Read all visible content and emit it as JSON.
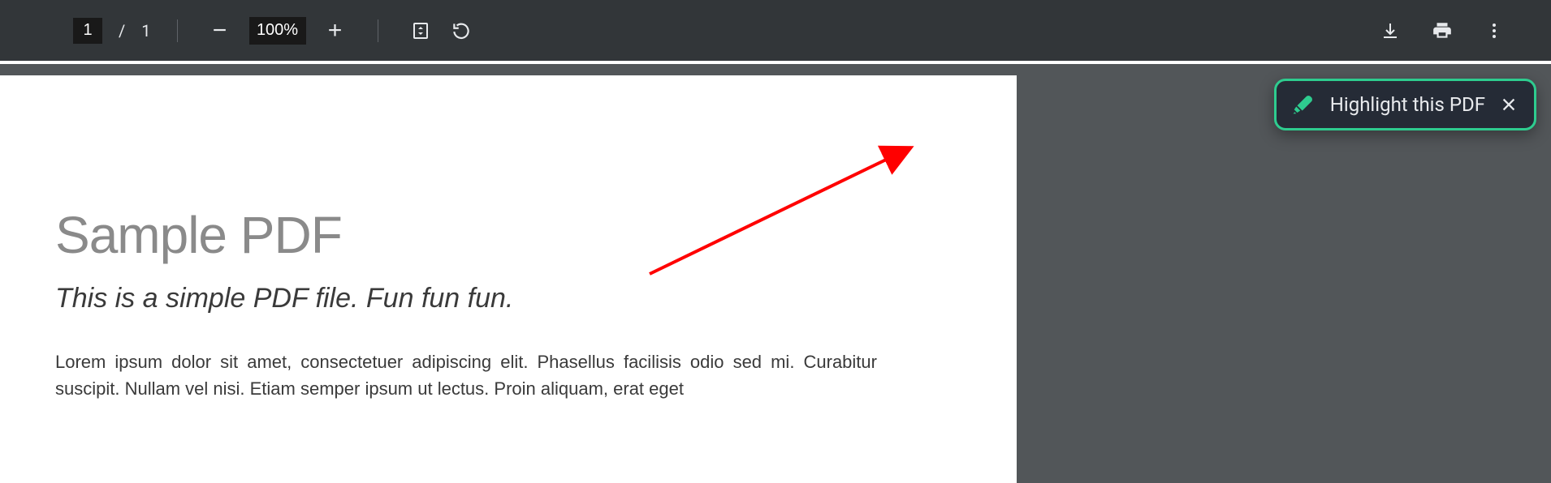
{
  "toolbar": {
    "page_current": "1",
    "page_separator": "/",
    "page_total": "1",
    "zoom_level": "100%"
  },
  "popup": {
    "label": "Highlight this PDF"
  },
  "document": {
    "title": "Sample PDF",
    "subtitle": "This is a simple PDF file. Fun fun fun.",
    "body_line1": "Lorem ipsum dolor sit amet, consectetuer adipiscing elit. Phasellus facilisis odio sed mi.",
    "body_line2": "Curabitur suscipit. Nullam vel nisi. Etiam semper ipsum ut lectus. Proin aliquam, erat eget"
  },
  "colors": {
    "toolbar_bg": "#323639",
    "viewer_bg": "#525659",
    "accent_green": "#2ecc8f",
    "arrow_red": "#ff0000"
  }
}
